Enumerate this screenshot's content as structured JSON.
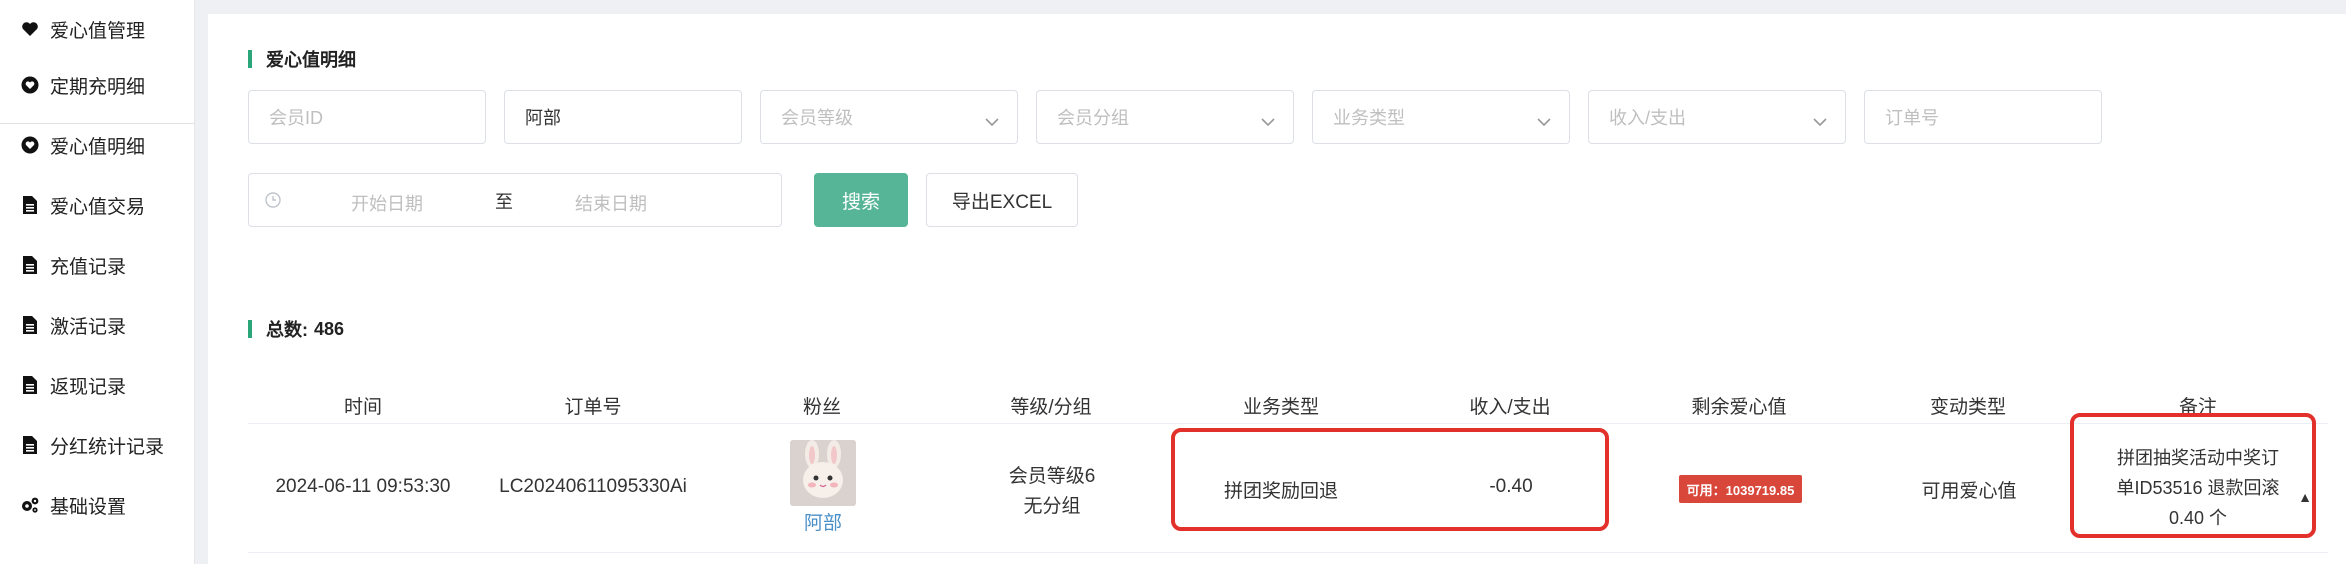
{
  "sidebar": {
    "items": [
      {
        "label": "爱心值管理",
        "icon": "heart-icon"
      },
      {
        "label": "定期充明细",
        "icon": "heart-circle-icon"
      },
      {
        "label": "爱心值明细",
        "icon": "heart-circle-icon"
      },
      {
        "label": "爱心值交易",
        "icon": "document-icon"
      },
      {
        "label": "充值记录",
        "icon": "document-icon"
      },
      {
        "label": "激活记录",
        "icon": "document-icon"
      },
      {
        "label": "返现记录",
        "icon": "document-icon"
      },
      {
        "label": "分红统计记录",
        "icon": "document-icon"
      },
      {
        "label": "基础设置",
        "icon": "gears-icon"
      }
    ]
  },
  "section_title": "爱心值明细",
  "filters": {
    "member_id": {
      "placeholder": "会员ID"
    },
    "name": {
      "value": "阿部"
    },
    "member_level": {
      "placeholder": "会员等级"
    },
    "member_group": {
      "placeholder": "会员分组"
    },
    "business_type": {
      "placeholder": "业务类型"
    },
    "income_expense": {
      "placeholder": "收入/支出"
    },
    "order_no": {
      "placeholder": "订单号"
    },
    "start_date": {
      "placeholder": "开始日期"
    },
    "to_label": "至",
    "end_date": {
      "placeholder": "结束日期"
    }
  },
  "buttons": {
    "search": "搜索",
    "export": "导出EXCEL"
  },
  "total": {
    "label": "总数:",
    "value": "486"
  },
  "table": {
    "headers": [
      "时间",
      "订单号",
      "粉丝",
      "等级/分组",
      "业务类型",
      "收入/支出",
      "剩余爱心值",
      "变动类型",
      "备注"
    ],
    "rows": [
      {
        "time": "2024-06-11 09:53:30",
        "order_no": "LC20240611095330Ai",
        "fan_name": "阿部",
        "level": "会员等级6",
        "group": "无分组",
        "business_type": "拼团奖励回退",
        "amount": "-0.40",
        "balance": "可用：1039719.85",
        "change_type": "可用爱心值",
        "remark_lines": [
          "拼团抽奖活动中奖订",
          "单ID53516 退款回滚",
          "0.40 个"
        ]
      }
    ]
  },
  "colors": {
    "accent": "#56b596",
    "section_bar": "#2aa67a",
    "badge": "#d9473a",
    "highlight": "#e2302a",
    "link": "#4a90c8"
  }
}
